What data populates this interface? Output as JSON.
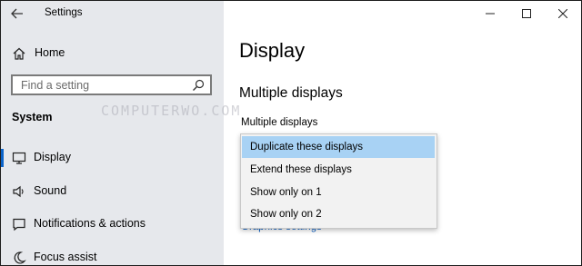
{
  "window": {
    "title": "Settings"
  },
  "sidebar": {
    "home_label": "Home",
    "search_placeholder": "Find a setting",
    "section_title": "System",
    "items": [
      {
        "label": "Display",
        "icon": "monitor-icon",
        "active": true
      },
      {
        "label": "Sound",
        "icon": "speaker-icon",
        "active": false
      },
      {
        "label": "Notifications & actions",
        "icon": "message-icon",
        "active": false
      },
      {
        "label": "Focus assist",
        "icon": "moon-icon",
        "active": false
      }
    ]
  },
  "main": {
    "page_title": "Display",
    "section_title": "Multiple displays",
    "field_label": "Multiple displays",
    "link_text": "Graphics settings",
    "dropdown_options": [
      {
        "label": "Duplicate these displays",
        "selected": true
      },
      {
        "label": "Extend these displays",
        "selected": false
      },
      {
        "label": "Show only on 1",
        "selected": false
      },
      {
        "label": "Show only on 2",
        "selected": false
      }
    ]
  },
  "watermark": "COMPUTERWO.COM",
  "colors": {
    "sidebar_bg": "#e6e8ec",
    "accent": "#0a63c9",
    "selected_bg": "#a8d2f4",
    "link": "#0a5ec2"
  }
}
